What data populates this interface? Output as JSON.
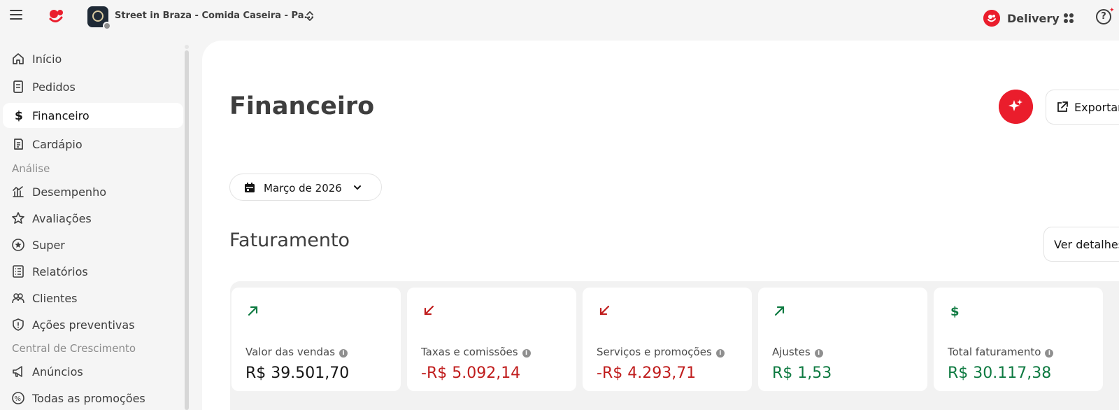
{
  "topbar": {
    "store_name": "Street in Braza - Comida Caseira - Pa...",
    "delivery_label": "Delivery",
    "help_symbol": "?"
  },
  "sidebar": {
    "items": [
      {
        "label": "Início",
        "icon": "home-icon"
      },
      {
        "label": "Pedidos",
        "icon": "receipt-icon"
      },
      {
        "label": "Financeiro",
        "icon": "dollar-icon",
        "active": true
      },
      {
        "label": "Cardápio",
        "icon": "menu-book-icon"
      }
    ],
    "section_analise": "Análise",
    "analise_items": [
      {
        "label": "Desempenho",
        "icon": "chart-icon"
      },
      {
        "label": "Avaliações",
        "icon": "star-icon"
      },
      {
        "label": "Super",
        "icon": "super-star-icon"
      },
      {
        "label": "Relatórios",
        "icon": "list-icon"
      },
      {
        "label": "Clientes",
        "icon": "users-icon"
      },
      {
        "label": "Ações preventivas",
        "icon": "shield-icon"
      }
    ],
    "section_crescimento": "Central de Crescimento",
    "crescimento_items": [
      {
        "label": "Anúncios",
        "icon": "megaphone-icon"
      },
      {
        "label": "Todas as promoções",
        "icon": "percent-icon"
      }
    ]
  },
  "main": {
    "title": "Financeiro",
    "export_label": "Exportar",
    "month_label": "Março de 2026",
    "section_title": "Faturamento",
    "details_label": "Ver detalhes"
  },
  "cards": [
    {
      "label": "Valor das vendas",
      "value": "R$ 39.501,70",
      "color": "#151515",
      "icon": "arrow-up-right-icon",
      "icon_color": "#0e7a41"
    },
    {
      "label": "Taxas e comissões",
      "value": "-R$ 5.092,14",
      "color": "#c01d1d",
      "icon": "arrow-down-left-icon",
      "icon_color": "#c01d1d"
    },
    {
      "label": "Serviços e promoções",
      "value": "-R$ 4.293,71",
      "color": "#c01d1d",
      "icon": "arrow-down-left-icon",
      "icon_color": "#c01d1d"
    },
    {
      "label": "Ajustes",
      "value": "R$ 1,53",
      "color": "#0e7a41",
      "icon": "arrow-up-right-icon",
      "icon_color": "#0e7a41"
    },
    {
      "label": "Total faturamento",
      "value": "R$ 30.117,38",
      "color": "#0e7a41",
      "icon": "dollar-icon",
      "icon_color": "#0e7a41"
    }
  ],
  "colors": {
    "brand": "#ea1d2c",
    "positive": "#0e7a41",
    "negative": "#c01d1d"
  }
}
